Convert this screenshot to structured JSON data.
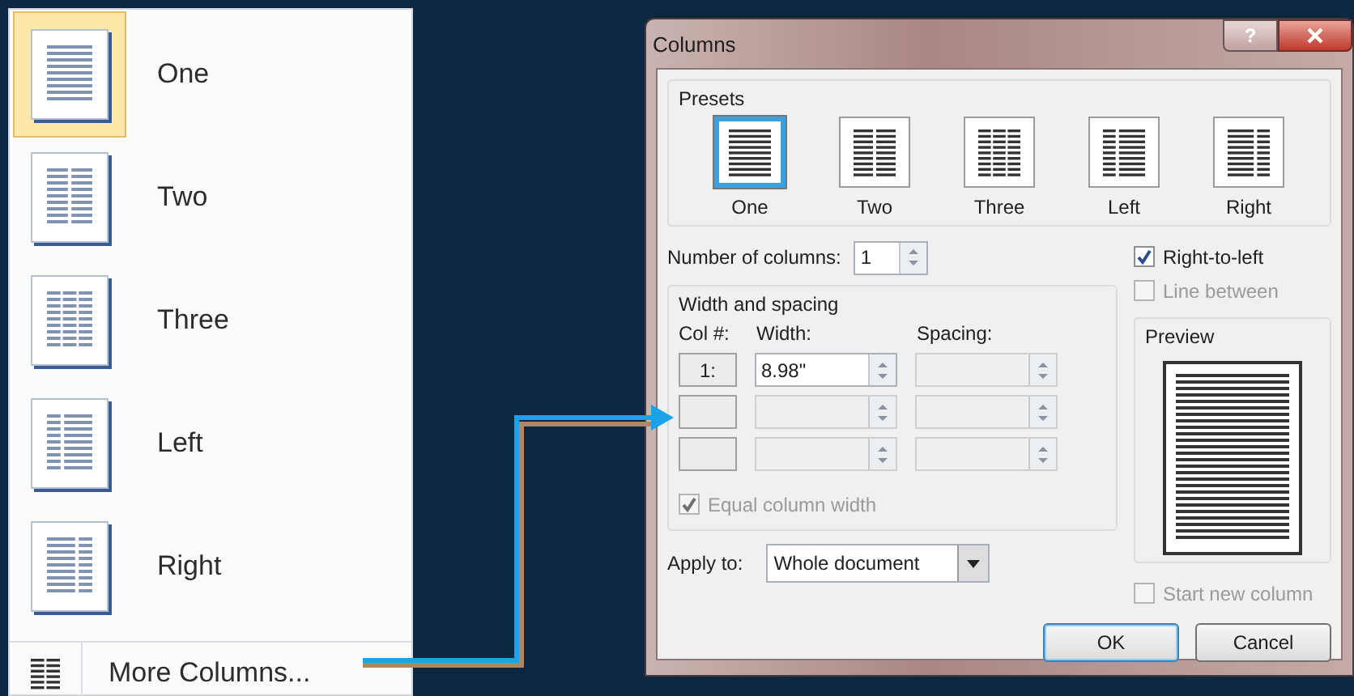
{
  "menu": {
    "items": [
      {
        "label": "One",
        "kind": "one",
        "selected": true
      },
      {
        "label": "Two",
        "kind": "two",
        "selected": false
      },
      {
        "label": "Three",
        "kind": "three",
        "selected": false
      },
      {
        "label": "Left",
        "kind": "left",
        "selected": false
      },
      {
        "label": "Right",
        "kind": "right",
        "selected": false
      }
    ],
    "footer": {
      "label": "More Columns..."
    }
  },
  "dialog": {
    "title": "Columns",
    "help_button": "?",
    "presets": {
      "title": "Presets",
      "items": [
        {
          "label": "One",
          "kind": "one",
          "selected": true
        },
        {
          "label": "Two",
          "kind": "two",
          "selected": false
        },
        {
          "label": "Three",
          "kind": "three",
          "selected": false
        },
        {
          "label": "Left",
          "kind": "left",
          "selected": false
        },
        {
          "label": "Right",
          "kind": "right",
          "selected": false
        }
      ]
    },
    "number_of_columns": {
      "label": "Number of columns:",
      "value": "1"
    },
    "right_to_left": {
      "label": "Right-to-left",
      "checked": true,
      "disabled": false
    },
    "line_between": {
      "label": "Line between",
      "checked": false,
      "disabled": true
    },
    "width_and_spacing": {
      "title": "Width and spacing",
      "columns": [
        "Col #:",
        "Width:",
        "Spacing:"
      ],
      "rows": [
        {
          "col": "1:",
          "width": "8.98\"",
          "width_disabled": false,
          "spacing_disabled": true
        },
        {
          "width_disabled": true,
          "spacing_disabled": true
        },
        {
          "width_disabled": true,
          "spacing_disabled": true
        }
      ]
    },
    "equal_column_width": {
      "label": "Equal column width",
      "checked": true,
      "disabled": true
    },
    "preview": {
      "title": "Preview"
    },
    "apply_to": {
      "label": "Apply to:",
      "value": "Whole document"
    },
    "start_new_column": {
      "label": "Start new column",
      "checked": false,
      "disabled": true
    },
    "buttons": [
      {
        "label": "OK",
        "default": true
      },
      {
        "label": "Cancel",
        "default": false
      }
    ]
  }
}
